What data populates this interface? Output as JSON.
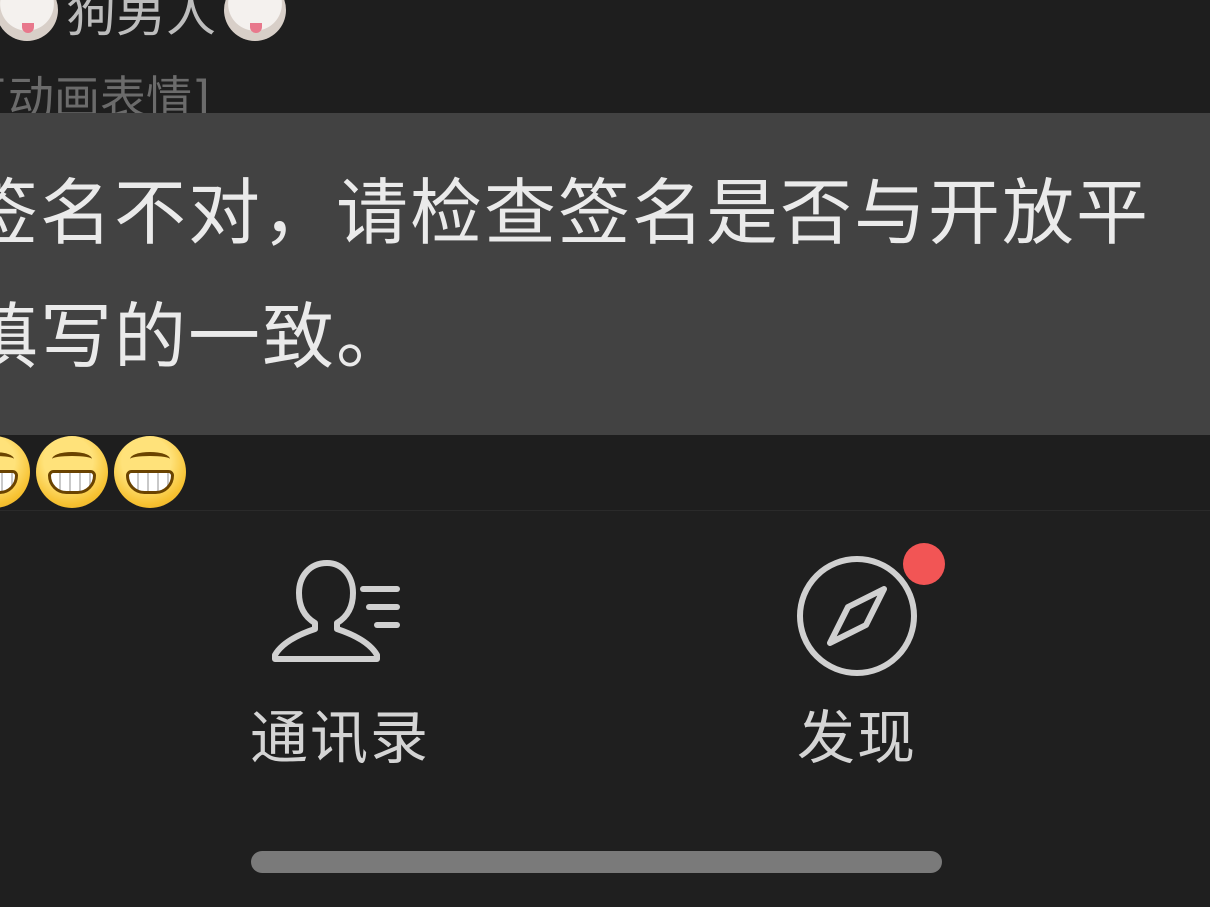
{
  "chat": {
    "top_text": "狗男人",
    "sticker_label": "[动画表情]",
    "quote_line1": "签名不对，请检查签名是否与开放平",
    "quote_line2": "填写的一致。",
    "emoji_icons": [
      "grinning-face-icon",
      "grinning-face-icon",
      "grinning-face-icon"
    ]
  },
  "tabbar": {
    "contacts_label": "通讯录",
    "discover_label": "发现",
    "discover_has_badge": true,
    "badge_color": "#f25555"
  },
  "colors": {
    "background": "#1e1e1e",
    "quote_background": "#424242",
    "label_text": "#d4d4d4"
  }
}
